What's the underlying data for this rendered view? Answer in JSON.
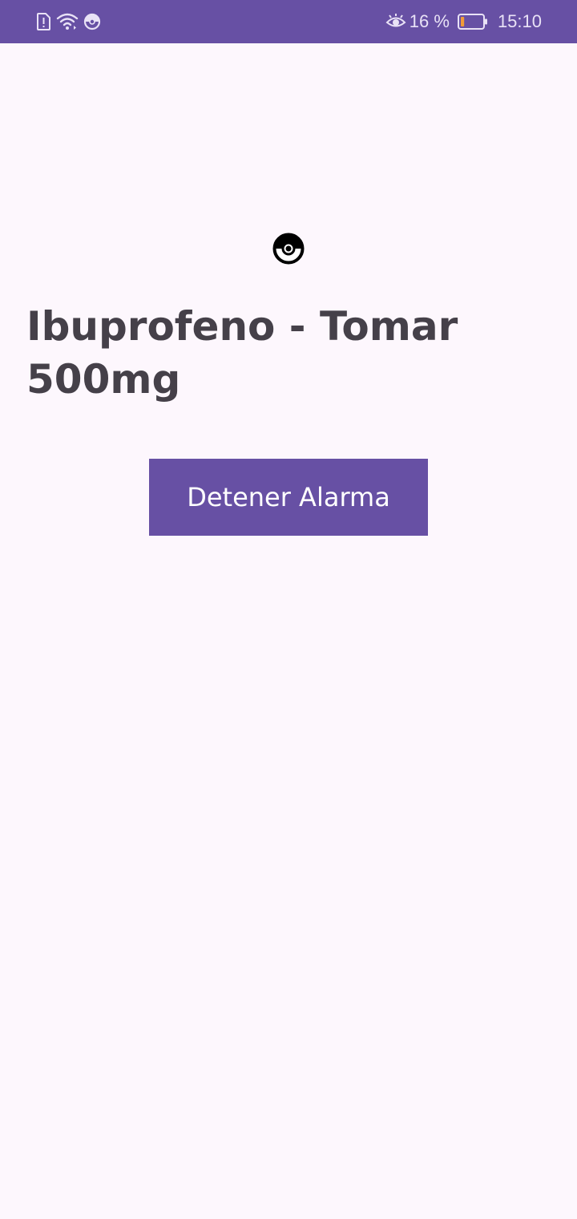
{
  "status_bar": {
    "left_icons": [
      "sim-alert-icon",
      "wifi-icon",
      "pokeball-notification-icon"
    ],
    "right_icons": [
      "eye-comfort-icon",
      "battery-icon"
    ],
    "battery_percent": "16 %",
    "battery_level": 0.16,
    "time": "15:10"
  },
  "alarm": {
    "icon": "pokeball-icon",
    "title": "Ibuprofeno - Tomar 500mg",
    "stop_button_label": "Detener Alarma"
  },
  "colors": {
    "primary": "#6750a4",
    "background": "#fdf7fd",
    "title_text": "#454049",
    "button_text": "#ffffff",
    "battery_low": "#f29b38"
  }
}
